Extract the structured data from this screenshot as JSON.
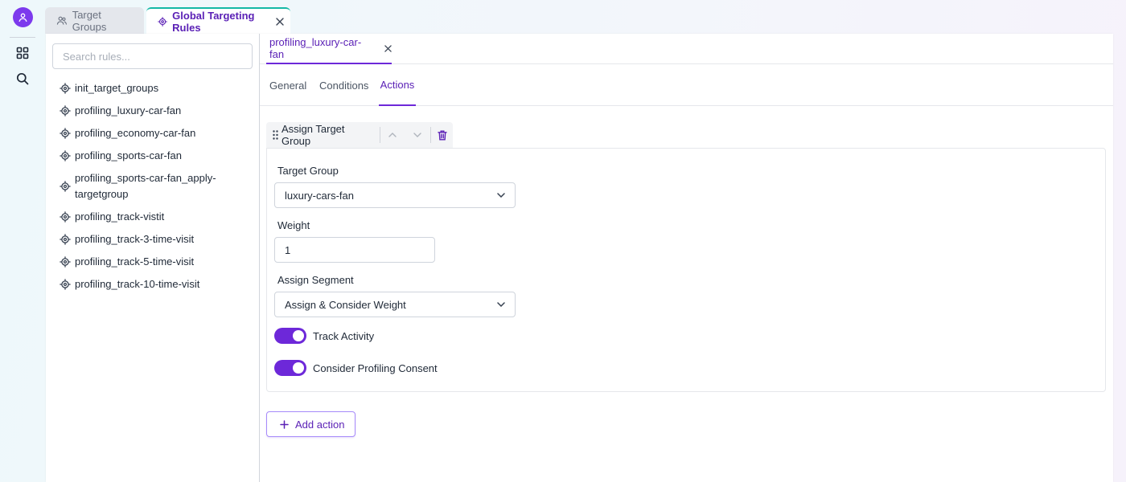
{
  "colors": {
    "accent": "#6d28d9",
    "tab_highlight": "#14b8a6"
  },
  "rail": {
    "icons": [
      "user-avatar-icon",
      "grid-icon",
      "search-icon"
    ]
  },
  "top_tabs": [
    {
      "label": "Target Groups",
      "icon": "users-icon"
    },
    {
      "label": "Global Targeting Rules",
      "icon": "target-icon",
      "active": true
    }
  ],
  "sidebar": {
    "search_placeholder": "Search rules...",
    "rules": [
      "init_target_groups",
      "profiling_luxury-car-fan",
      "profiling_economy-car-fan",
      "profiling_sports-car-fan",
      "profiling_sports-car-fan_apply-targetgroup",
      "profiling_track-vistit",
      "profiling_track-3-time-visit",
      "profiling_track-5-time-visit",
      "profiling_track-10-time-visit"
    ]
  },
  "editor": {
    "open_tab": "profiling_luxury-car-fan",
    "sub_tabs": [
      "General",
      "Conditions",
      "Actions"
    ],
    "active_sub_tab": "Actions",
    "action": {
      "title": "Assign Target Group",
      "target_group_label": "Target Group",
      "target_group_value": "luxury-cars-fan",
      "weight_label": "Weight",
      "weight_value": "1",
      "assign_segment_label": "Assign Segment",
      "assign_segment_value": "Assign & Consider Weight",
      "track_activity_label": "Track Activity",
      "track_activity_on": true,
      "profiling_consent_label": "Consider Profiling Consent",
      "profiling_consent_on": true
    },
    "add_action_label": "Add action"
  }
}
